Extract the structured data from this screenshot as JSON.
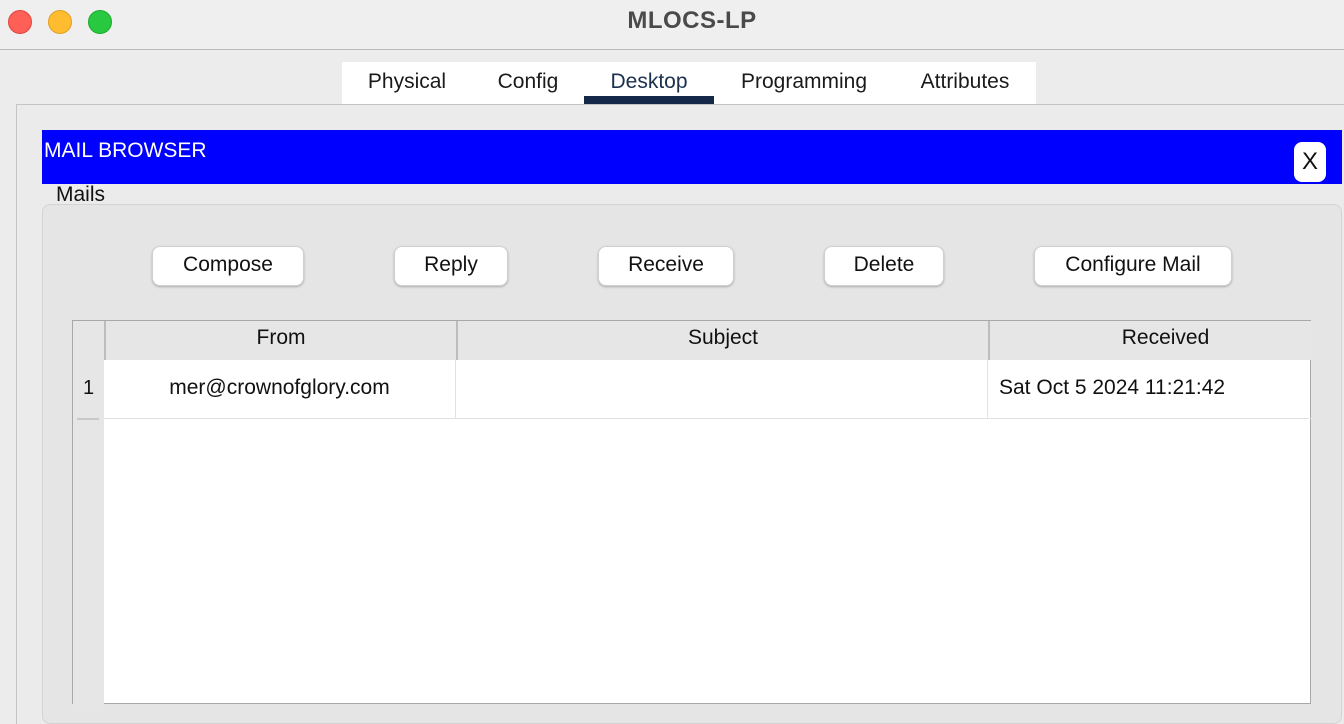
{
  "window": {
    "title": "MLOCS-LP",
    "controls": [
      "close",
      "minimize",
      "zoom"
    ]
  },
  "tabs": [
    {
      "label": "Physical",
      "active": false
    },
    {
      "label": "Config",
      "active": false
    },
    {
      "label": "Desktop",
      "active": true
    },
    {
      "label": "Programming",
      "active": false
    },
    {
      "label": "Attributes",
      "active": false
    }
  ],
  "mail_browser": {
    "title": "MAIL BROWSER",
    "close_label": "X",
    "group_label": "Mails",
    "buttons": {
      "compose": "Compose",
      "reply": "Reply",
      "receive": "Receive",
      "delete": "Delete",
      "configure": "Configure Mail"
    },
    "table": {
      "columns": [
        "From",
        "Subject",
        "Received"
      ],
      "rows": [
        {
          "number": "1",
          "from": "mer@crownofglory.com",
          "subject": "",
          "received": "Sat Oct 5 2024 11:21:42"
        }
      ]
    }
  },
  "colors": {
    "header_blue": "#0000ff",
    "active_tab_underline": "#14284a"
  }
}
